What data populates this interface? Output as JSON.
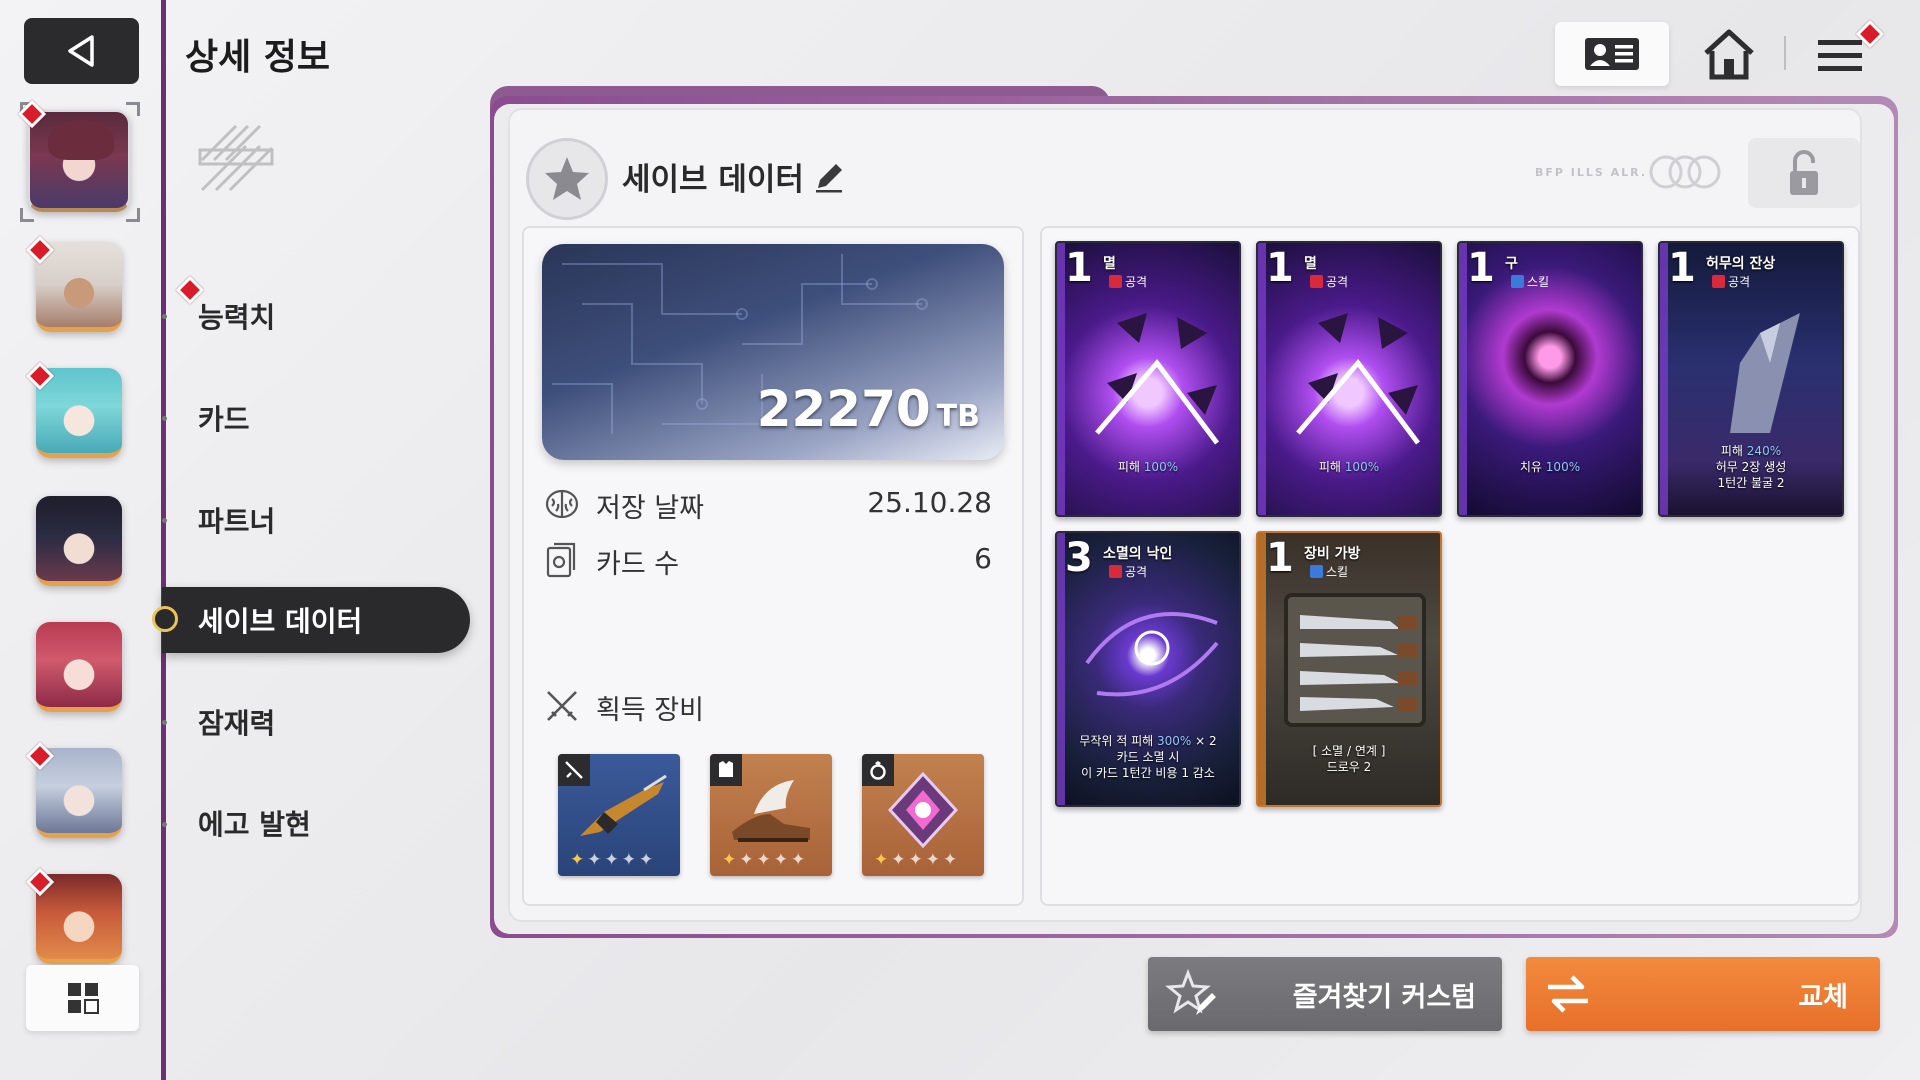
{
  "header": {
    "title": "상세 정보",
    "back_icon": "back-arrow-icon",
    "profile_icon": "id-card-icon",
    "home_icon": "home-icon",
    "menu_icon": "hamburger-menu-icon"
  },
  "characters": [
    {
      "name": "character-1",
      "selected": true,
      "alert": true
    },
    {
      "name": "character-2",
      "selected": false,
      "alert": true
    },
    {
      "name": "character-3",
      "selected": false,
      "alert": true
    },
    {
      "name": "character-4",
      "selected": false,
      "alert": false
    },
    {
      "name": "character-5",
      "selected": false,
      "alert": false
    },
    {
      "name": "character-6",
      "selected": false,
      "alert": true
    },
    {
      "name": "character-7",
      "selected": false,
      "alert": true
    }
  ],
  "side_menu": {
    "items": [
      {
        "label": "능력치",
        "alert": true
      },
      {
        "label": "카드",
        "alert": false
      },
      {
        "label": "파트너",
        "alert": false
      },
      {
        "label": "세이브 데이터",
        "active": true
      },
      {
        "label": "잠재력",
        "alert": false
      },
      {
        "label": "에고 발현",
        "alert": false
      }
    ]
  },
  "save": {
    "title": "세이브 데이터",
    "tb_value": "22270",
    "tb_unit": "TB",
    "date_label": "저장 날짜",
    "date_value": "25.10.28",
    "cards_label": "카드 수",
    "cards_value": "6",
    "equipment_label": "획득 장비",
    "equipment": [
      {
        "name": "harpoon-gun",
        "slot": "weapon",
        "stars": 1
      },
      {
        "name": "winged-boots",
        "slot": "armor",
        "stars": 1
      },
      {
        "name": "crystal-ring",
        "slot": "ring",
        "stars": 1
      }
    ]
  },
  "cards": [
    {
      "cost": "1",
      "name": "멸",
      "type": "공격",
      "desc": [
        "피해 100%"
      ],
      "hl": "100%"
    },
    {
      "cost": "1",
      "name": "멸",
      "type": "공격",
      "desc": [
        "피해 100%"
      ],
      "hl": "100%"
    },
    {
      "cost": "1",
      "name": "구",
      "type": "스킬",
      "desc": [
        "치유 100%"
      ],
      "hl": "100%"
    },
    {
      "cost": "1",
      "name": "허무의 잔상",
      "type": "공격",
      "desc": [
        "피해 240%",
        "허무 2장 생성",
        "1턴간 불굴 2"
      ]
    },
    {
      "cost": "3",
      "name": "소멸의 낙인",
      "type": "공격",
      "desc": [
        "무작위 적 피해 300% × 2",
        "카드 소멸 시",
        "이 카드 1턴간 비용 1 감소"
      ]
    },
    {
      "cost": "1",
      "name": "장비 가방",
      "type": "스킬",
      "desc": [
        "[ 소멸 / 연계 ]",
        "드로우 2"
      ]
    }
  ],
  "buttons": {
    "favorite": "즐겨찾기 커스텀",
    "swap": "교체"
  },
  "colors": {
    "accent_purple": "#8b4c8f",
    "swap_orange": "#ef7e34",
    "alert_red": "#d91c2a"
  }
}
